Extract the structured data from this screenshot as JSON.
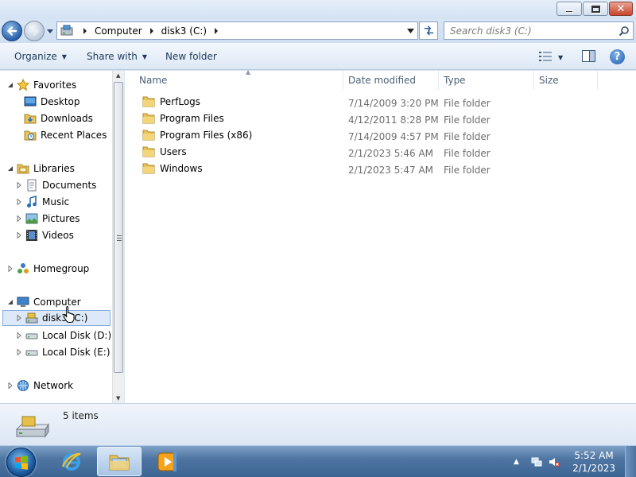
{
  "window": {
    "address": {
      "crumbs": [
        "Computer",
        "disk3 (C:)"
      ]
    },
    "search_placeholder": "Search disk3 (C:)"
  },
  "commandbar": {
    "organize": "Organize",
    "share_with": "Share with",
    "new_folder": "New folder",
    "view_icon": "change-view-icon",
    "preview_icon": "preview-pane-icon",
    "help_icon": "help-icon"
  },
  "nav": {
    "favorites": {
      "label": "Favorites",
      "items": [
        "Desktop",
        "Downloads",
        "Recent Places"
      ]
    },
    "libraries": {
      "label": "Libraries",
      "items": [
        "Documents",
        "Music",
        "Pictures",
        "Videos"
      ]
    },
    "homegroup": "Homegroup",
    "computer": {
      "label": "Computer",
      "items": [
        "disk3 (C:)",
        "Local Disk (D:)",
        "Local Disk (E:)"
      ]
    },
    "network": "Network"
  },
  "columns": {
    "name": "Name",
    "date": "Date modified",
    "type": "Type",
    "size": "Size"
  },
  "files": [
    {
      "name": "PerfLogs",
      "date": "7/14/2009 3:20 PM",
      "type": "File folder",
      "size": ""
    },
    {
      "name": "Program Files",
      "date": "4/12/2011 8:28 PM",
      "type": "File folder",
      "size": ""
    },
    {
      "name": "Program Files (x86)",
      "date": "7/14/2009 4:57 PM",
      "type": "File folder",
      "size": ""
    },
    {
      "name": "Users",
      "date": "2/1/2023 5:46 AM",
      "type": "File folder",
      "size": ""
    },
    {
      "name": "Windows",
      "date": "2/1/2023 5:47 AM",
      "type": "File folder",
      "size": ""
    }
  ],
  "details": {
    "item_count": "5 items"
  },
  "taskbar": {
    "time": "5:52 AM",
    "date": "2/1/2023",
    "pinned": [
      "internet-explorer-icon",
      "windows-explorer-icon",
      "media-player-icon"
    ]
  },
  "colors": {
    "accent": "#1e395b",
    "folder": "#e8c35a",
    "selection": "#dde9f8"
  }
}
